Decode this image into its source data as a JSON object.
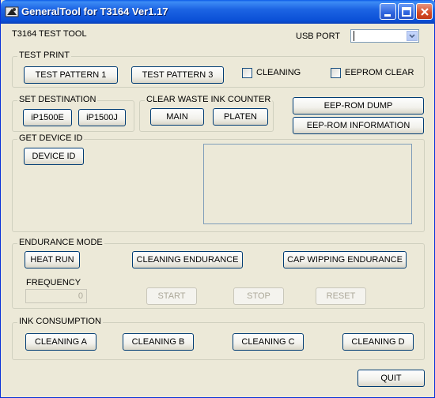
{
  "window": {
    "title": "GeneralTool for T3164 Ver1.17"
  },
  "header": {
    "tool_label": "T3164 TEST TOOL",
    "usb_port_label": "USB PORT",
    "usb_port_value": ""
  },
  "test_print": {
    "title": "TEST PRINT",
    "pattern1": "TEST PATTERN 1",
    "pattern3": "TEST PATTERN 3",
    "cleaning": "CLEANING",
    "eeprom_clear": "EEPROM CLEAR"
  },
  "set_destination": {
    "title": "SET DESTINATION",
    "ip1500e": "iP1500E",
    "ip1500j": "iP1500J"
  },
  "waste_ink": {
    "title": "CLEAR WASTE INK COUNTER",
    "main": "MAIN",
    "platen": "PLATEN"
  },
  "eeprom": {
    "dump": "EEP-ROM DUMP",
    "information": "EEP-ROM INFORMATION"
  },
  "device_id": {
    "title": "GET DEVICE ID",
    "button": "DEVICE ID",
    "output": ""
  },
  "endurance": {
    "title": "ENDURANCE MODE",
    "heat_run": "HEAT RUN",
    "cleaning_endurance": "CLEANING ENDURANCE",
    "cap_wipping_endurance": "CAP WIPPING ENDURANCE",
    "frequency_label": "FREQUENCY",
    "frequency_value": "0",
    "start": "START",
    "stop": "STOP",
    "reset": "RESET"
  },
  "ink_consumption": {
    "title": "INK CONSUMPTION",
    "cleaning_a": "CLEANING A",
    "cleaning_b": "CLEANING B",
    "cleaning_c": "CLEANING C",
    "cleaning_d": "CLEANING D"
  },
  "footer": {
    "quit": "QUIT"
  },
  "colors": {
    "titlebar": "#0a4fd6",
    "dialog_bg": "#ece9d8",
    "button_border": "#003c74"
  }
}
